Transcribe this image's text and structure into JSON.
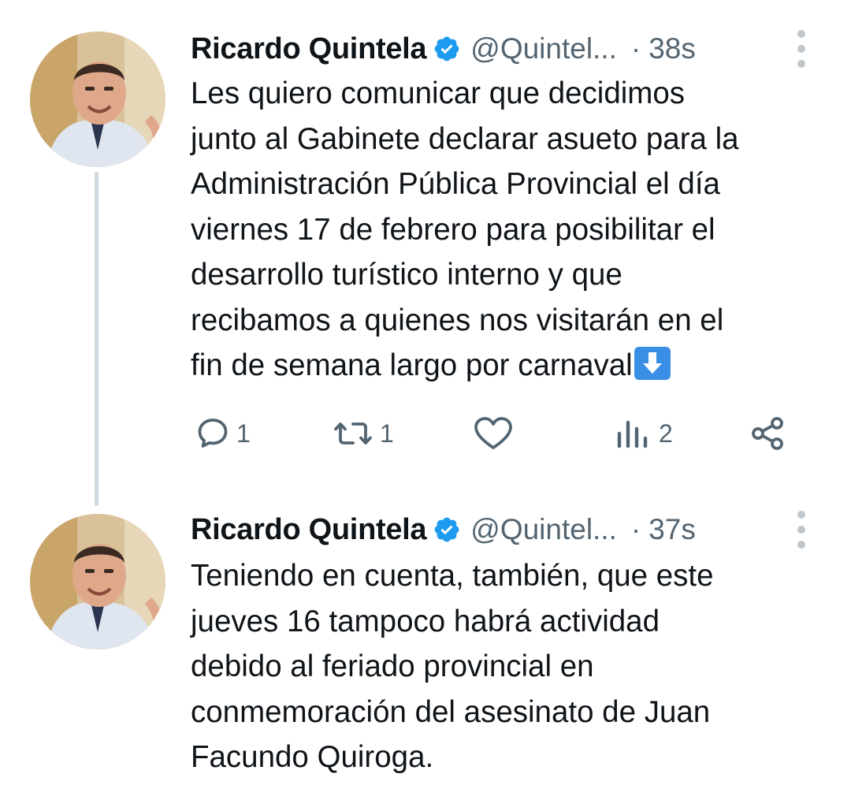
{
  "tweets": [
    {
      "author_name": "Ricardo Quintela",
      "handle": "@Quintel...",
      "separator": "·",
      "time": "38s",
      "text": "Les quiero comunicar que decidimos\njunto al Gabinete declarar asueto para la\nAdministración Pública Provincial el día\nviernes 17 de febrero para posibilitar el\ndesarrollo turístico interno y que\nrecibamos a quienes nos visitarán en el\nfin de semana largo por carnaval",
      "emoji": "down-arrow-emoji",
      "actions": {
        "reply_icon": "reply-icon",
        "reply_count": "1",
        "retweet_icon": "retweet-icon",
        "retweet_count": "1",
        "like_icon": "heart-icon",
        "like_count": "",
        "views_icon": "views-icon",
        "views_count": "2",
        "share_icon": "share-icon"
      }
    },
    {
      "author_name": "Ricardo Quintela",
      "handle": "@Quintel...",
      "separator": "·",
      "time": "37s",
      "text": "Teniendo en cuenta, también, que este\njueves 16 tampoco habrá actividad\ndebido al feriado provincial en\nconmemoración del asesinato de Juan\nFacundo Quiroga."
    }
  ],
  "colors": {
    "verified": "#1d9bf0",
    "secondary_text": "#536471",
    "thread_line": "#cfd9de",
    "primary_text": "#0f1419"
  }
}
